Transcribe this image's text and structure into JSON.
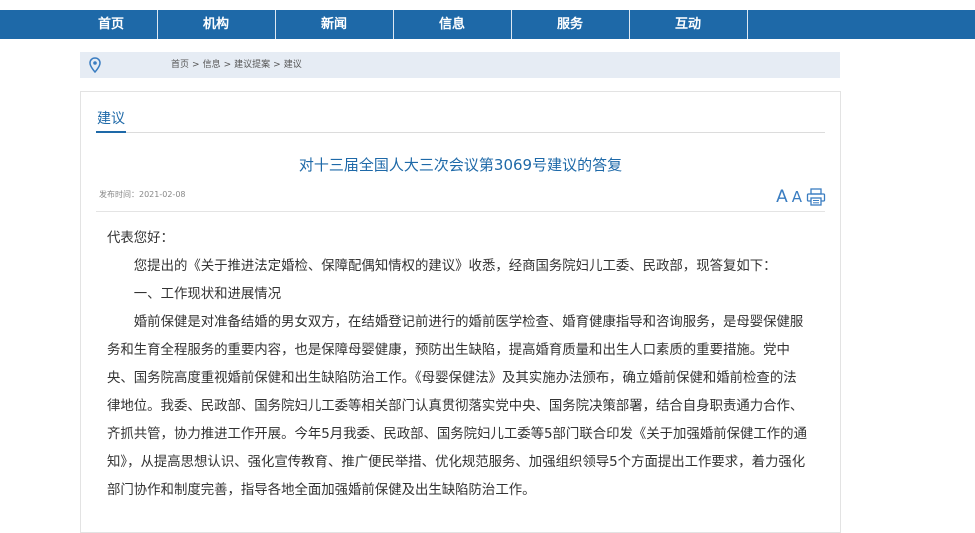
{
  "nav": {
    "items": [
      "首页",
      "机构",
      "新闻",
      "信息",
      "服务",
      "互动"
    ]
  },
  "breadcrumb": {
    "items": [
      "首页",
      "信息",
      "建议提案",
      "建议"
    ],
    "separator": ">"
  },
  "section": {
    "title": "建议"
  },
  "article": {
    "title": "对十三届全国人大三次会议第3069号建议的答复",
    "date_label": "发布时间：",
    "date": "2021-02-08",
    "font_large_label": "A",
    "font_small_label": "A",
    "paragraphs": [
      "代表您好：",
      "您提出的《关于推进法定婚检、保障配偶知情权的建议》收悉，经商国务院妇儿工委、民政部，现答复如下：",
      "一、工作现状和进展情况",
      "婚前保健是对准备结婚的男女双方，在结婚登记前进行的婚前医学检查、婚育健康指导和咨询服务，是母婴保健服务和生育全程服务的重要内容，也是保障母婴健康，预防出生缺陷，提高婚育质量和出生人口素质的重要措施。党中央、国务院高度重视婚前保健和出生缺陷防治工作。《母婴保健法》及其实施办法颁布，确立婚前保健和婚前检查的法律地位。我委、民政部、国务院妇儿工委等相关部门认真贯彻落实党中央、国务院决策部署，结合自身职责通力合作、齐抓共管，协力推进工作开展。今年5月我委、民政部、国务院妇儿工委等5部门联合印发《关于加强婚前保健工作的通知》，从提高思想认识、强化宣传教育、推广便民举措、优化规范服务、加强组织领导5个方面提出工作要求，着力强化部门协作和制度完善，指导各地全面加强婚前保健及出生缺陷防治工作。"
    ]
  },
  "colors": {
    "nav_bg": "#1e69a8",
    "accent": "#1e69a8",
    "crumb_bg": "#e6ecf4"
  },
  "icons": {
    "location": "location-pin-icon",
    "print": "print-icon"
  }
}
